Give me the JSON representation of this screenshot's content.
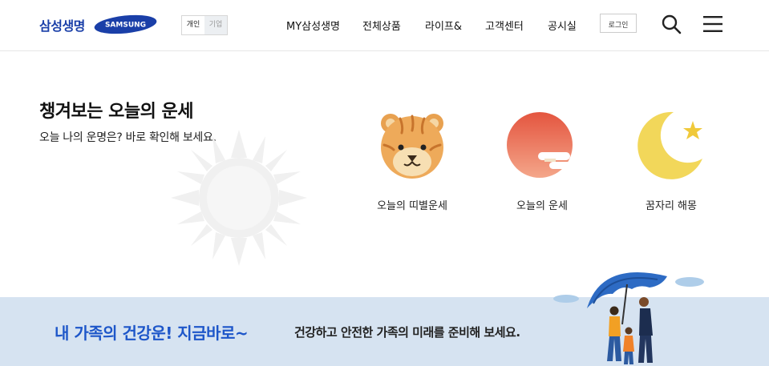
{
  "header": {
    "logo_kr": "삼성생명",
    "logo_en": "SAMSUNG",
    "segment": {
      "personal": "개인",
      "corporate": "기업"
    },
    "nav": [
      "MY삼성생명",
      "전체상품",
      "라이프&",
      "고객센터",
      "공시실"
    ],
    "login": "로그인",
    "icons": {
      "search": "search-icon",
      "menu": "hamburger-menu-icon"
    }
  },
  "fortune": {
    "title": "챙겨보는 오늘의 운세",
    "subtitle": "오늘 나의 운명은? 바로 확인해 보세요.",
    "cards": [
      {
        "label": "오늘의 띠별운세",
        "icon": "tiger-icon"
      },
      {
        "label": "오늘의 운세",
        "icon": "sunrise-icon"
      },
      {
        "label": "꿈자리 해몽",
        "icon": "moon-star-icon"
      }
    ]
  },
  "banner": {
    "title": "내 가족의 건강운! 지금바로~",
    "subtitle": "건강하고 안전한 가족의 미래를 준비해 보세요."
  },
  "colors": {
    "brand_blue": "#1a3fa8",
    "banner_bg": "#d6e3f1",
    "banner_title": "#1d56c9"
  }
}
